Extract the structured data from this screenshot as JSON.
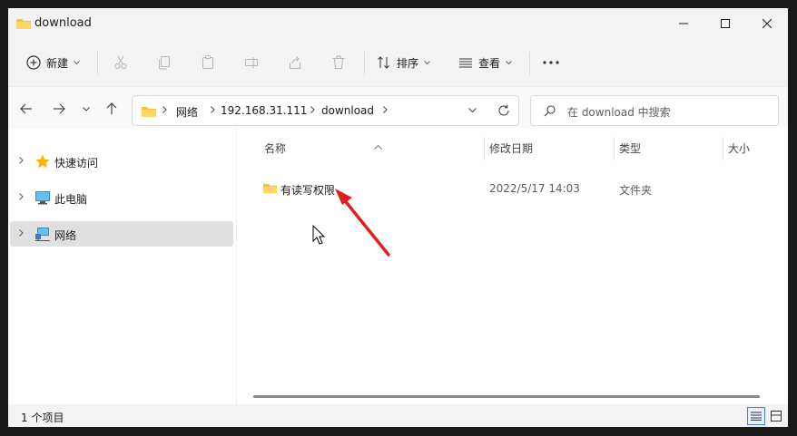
{
  "window": {
    "title": "download"
  },
  "toolbar": {
    "new_label": "新建",
    "sort_label": "排序",
    "view_label": "查看",
    "more_icon": "more-icon"
  },
  "nav": {
    "breadcrumbs": [
      "网络",
      "192.168.31.111",
      "download"
    ],
    "search_placeholder": "在 download 中搜索"
  },
  "sidebar": {
    "items": [
      {
        "label": "快速访问",
        "icon": "star-icon"
      },
      {
        "label": "此电脑",
        "icon": "computer-icon"
      },
      {
        "label": "网络",
        "icon": "network-icon",
        "selected": true
      }
    ]
  },
  "file_list": {
    "columns": [
      "名称",
      "修改日期",
      "类型",
      "大小"
    ],
    "rows": [
      {
        "name": "有读写权限",
        "modified": "2022/5/17 14:03",
        "type": "文件夹",
        "size": ""
      }
    ]
  },
  "status": {
    "item_count": "1 个项目"
  },
  "colors": {
    "annotation_arrow": "#e02020",
    "folder": "#f5c33b",
    "selection": "#e0e0e0"
  }
}
